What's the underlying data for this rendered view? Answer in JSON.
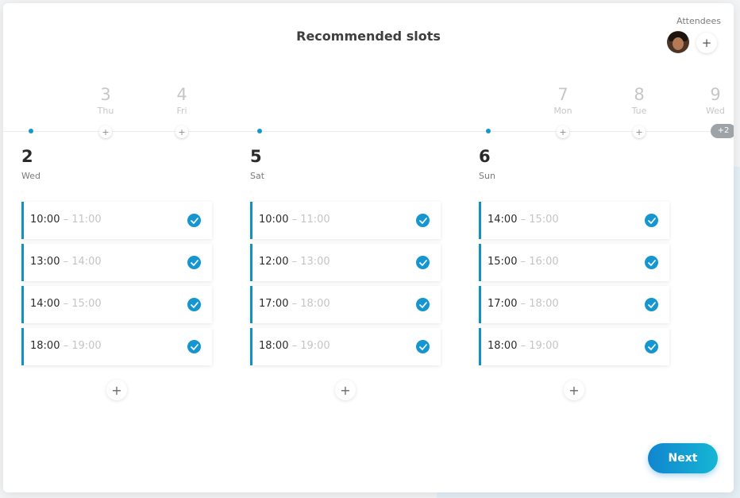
{
  "modal": {
    "title": "Recommended slots",
    "next_label": "Next"
  },
  "attendees": {
    "label": "Attendees",
    "add_icon": "+"
  },
  "timeline": {
    "inactive_days": [
      {
        "num": "3",
        "dow": "Thu"
      },
      {
        "num": "4",
        "dow": "Fri"
      },
      {
        "num": "7",
        "dow": "Mon"
      },
      {
        "num": "8",
        "dow": "Tue"
      },
      {
        "num": "9",
        "dow": "Wed"
      }
    ],
    "more_badge": "+2",
    "plus_icon": "+"
  },
  "columns": [
    {
      "day_num": "2",
      "dow": "Wed",
      "slots": [
        {
          "start": "10:00",
          "end": "11:00"
        },
        {
          "start": "13:00",
          "end": "14:00"
        },
        {
          "start": "14:00",
          "end": "15:00"
        },
        {
          "start": "18:00",
          "end": "19:00"
        }
      ]
    },
    {
      "day_num": "5",
      "dow": "Sat",
      "slots": [
        {
          "start": "10:00",
          "end": "11:00"
        },
        {
          "start": "12:00",
          "end": "13:00"
        },
        {
          "start": "17:00",
          "end": "18:00"
        },
        {
          "start": "18:00",
          "end": "19:00"
        }
      ]
    },
    {
      "day_num": "6",
      "dow": "Sun",
      "slots": [
        {
          "start": "14:00",
          "end": "15:00"
        },
        {
          "start": "15:00",
          "end": "16:00"
        },
        {
          "start": "17:00",
          "end": "18:00"
        },
        {
          "start": "18:00",
          "end": "19:00"
        }
      ]
    }
  ],
  "slot_separator": " – ",
  "add_slot_icon": "+",
  "icons": {
    "avatar": "attendee-avatar",
    "check": "check-circle-icon",
    "plus": "plus-icon"
  },
  "colors": {
    "accent": "#1596d0",
    "slot_border": "#1190c8",
    "button_gradient_start": "#1185cf",
    "button_gradient_end": "#16b6d4",
    "inactive_day": "#c7c7c7",
    "badge": "#9ea3a7"
  }
}
